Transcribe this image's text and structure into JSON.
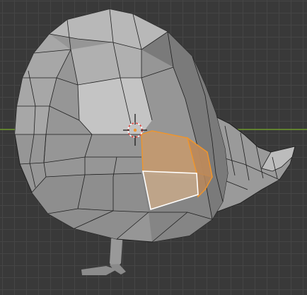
{
  "viewport": {
    "mode": "edit-mode",
    "view": "perspective"
  },
  "scene": {
    "object": "bird-mesh",
    "selection_type": "faces",
    "selected_faces": 2,
    "active_face": "lower-selected-face"
  },
  "colors": {
    "background": "#393939",
    "grid_line": "#454545",
    "x_axis": "#6f9a2c",
    "mesh_light": "#bdbdbd",
    "mesh_mid": "#9c9c9c",
    "mesh_dark": "#727272",
    "edge": "#1e1e1e",
    "selection": "#f0952a",
    "active_face_outline": "#ffffff",
    "cursor_red": "#e0403a"
  },
  "icons": {
    "cursor": "3d-cursor-icon"
  }
}
